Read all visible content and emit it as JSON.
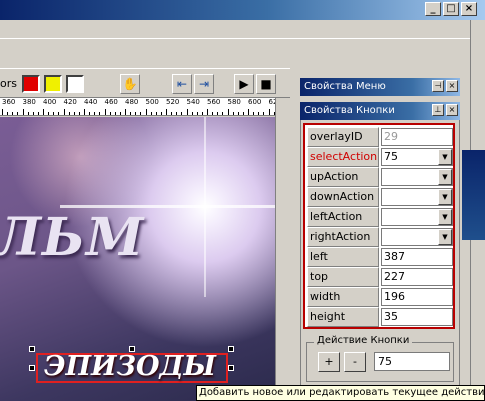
{
  "window": {
    "btn_min": "_",
    "btn_max": "□",
    "btn_close": "×"
  },
  "toolbar": {
    "colors_label": "ors",
    "swatches": [
      "#e00000",
      "#f0f000",
      "#ffffff"
    ],
    "play_icon": "▶",
    "stop_icon": "■"
  },
  "ruler": {
    "numbers": [
      "360",
      "380",
      "400",
      "420",
      "440",
      "460",
      "480",
      "500",
      "520",
      "540",
      "560",
      "580",
      "600",
      "620"
    ]
  },
  "canvas": {
    "headline": "ЛЬМ",
    "button_text": "ЭПИЗОДЫ"
  },
  "menu_panel": {
    "title": "Свойства Меню"
  },
  "button_panel": {
    "title": "Свойства Кнопки",
    "rows": [
      {
        "name": "overlayID",
        "value": "29",
        "dropdown": false,
        "disabled": true,
        "highlight": false
      },
      {
        "name": "selectAction",
        "value": "75",
        "dropdown": true,
        "disabled": false,
        "highlight": true
      },
      {
        "name": "upAction",
        "value": "",
        "dropdown": true,
        "disabled": false,
        "highlight": false
      },
      {
        "name": "downAction",
        "value": "",
        "dropdown": true,
        "disabled": false,
        "highlight": false
      },
      {
        "name": "leftAction",
        "value": "",
        "dropdown": true,
        "disabled": false,
        "highlight": false
      },
      {
        "name": "rightAction",
        "value": "",
        "dropdown": true,
        "disabled": false,
        "highlight": false
      },
      {
        "name": "left",
        "value": "387",
        "dropdown": false,
        "disabled": false,
        "highlight": false
      },
      {
        "name": "top",
        "value": "227",
        "dropdown": false,
        "disabled": false,
        "highlight": false
      },
      {
        "name": "width",
        "value": "196",
        "dropdown": false,
        "disabled": false,
        "highlight": false
      },
      {
        "name": "height",
        "value": "35",
        "dropdown": false,
        "disabled": false,
        "highlight": false
      }
    ],
    "action_group": {
      "label": "Действие Кнопки",
      "plus": "+",
      "minus": "-",
      "value": "75"
    }
  },
  "tooltip": "Добавить новое или редактировать текущее действие",
  "colors": {
    "highlight_red": "#d00000",
    "caption_blue": "#0a246a"
  }
}
